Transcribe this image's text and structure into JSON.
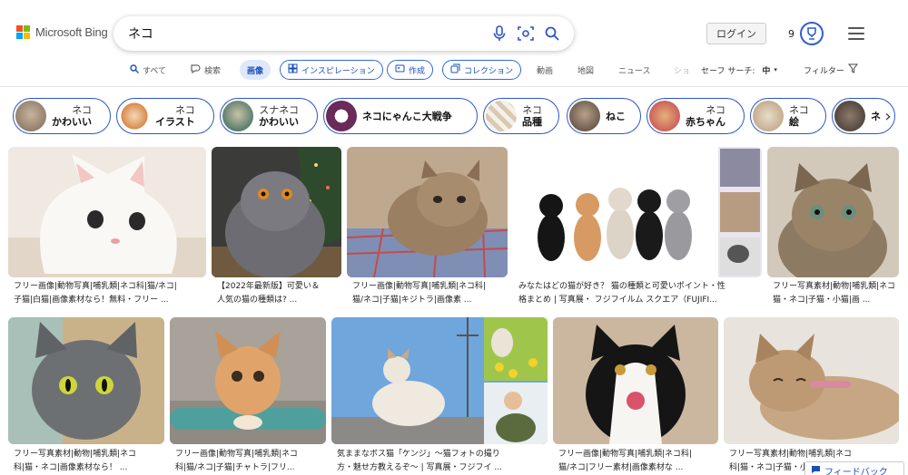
{
  "brand": {
    "name": "Microsoft Bing",
    "colors": [
      "#f25022",
      "#7fba00",
      "#00a4ef",
      "#ffb900"
    ]
  },
  "search": {
    "query": "ネコ"
  },
  "header": {
    "login_label": "ログイン",
    "rewards_count": "9"
  },
  "nav": {
    "items": [
      {
        "label": "すべて",
        "icon": "search-icon"
      },
      {
        "label": "検索",
        "icon": "copilot-icon"
      },
      {
        "label": "画像",
        "icon": ""
      },
      {
        "label": "インスピレーション",
        "icon": "inspiration-icon"
      },
      {
        "label": "作成",
        "icon": "create-icon"
      },
      {
        "label": "コレクション",
        "icon": "collection-icon"
      },
      {
        "label": "動画",
        "icon": ""
      },
      {
        "label": "地図",
        "icon": ""
      },
      {
        "label": "ニュース",
        "icon": ""
      },
      {
        "label": "ショ",
        "icon": ""
      }
    ],
    "safe_search_label": "セーフ サーチ:",
    "safe_search_value": "中",
    "filter_label": "フィルター"
  },
  "chips": [
    {
      "top": "ネコ",
      "bottom": "かわいい"
    },
    {
      "top": "ネコ",
      "bottom": "イラスト"
    },
    {
      "top": "スナネコ",
      "bottom": "かわいい"
    },
    {
      "top": "",
      "bottom": "ネコにゃんこ大戦争"
    },
    {
      "top": "ネコ",
      "bottom": "品種"
    },
    {
      "top": "",
      "bottom": "ねこ"
    },
    {
      "top": "ネコ",
      "bottom": "赤ちゃん"
    },
    {
      "top": "ネコ",
      "bottom": "絵"
    },
    {
      "top": "",
      "bottom": "ネ"
    }
  ],
  "results": [
    {
      "line1": "フリー画像|動物写真|哺乳類|ネコ科|猫/ネコ|",
      "line2": "子猫|白猫|画像素材なら！無料・フリー ..."
    },
    {
      "line1": "【2022年最新版】可愛い＆",
      "line2": "人気の猫の種類は? ..."
    },
    {
      "line1": "フリー画像|動物写真|哺乳類|ネコ科|",
      "line2": "猫/ネコ|子猫|キジトラ|画像素 ..."
    },
    {
      "line1": "みなたはどの猫が好き？ 猫の種類と可愛いポイント・性",
      "line2": "格まとめ | 写真展・ フジフイルム スクエア（FUJIFI..."
    },
    {
      "line1": "フリー写真素材|動物|哺乳類|ネコ",
      "line2": "猫・ネコ|子猫・小猫|画 ..."
    },
    {
      "line1": "フリー写真素材|動物|哺乳類|ネコ",
      "line2": "科|猫・ネコ|画像素材なら！ ..."
    },
    {
      "line1": "フリー画像|動物写真|哺乳類|ネコ",
      "line2": "科|猫/ネコ|子猫|チャトラ|フリ..."
    },
    {
      "line1": "気ままなボス猫「ケンジ」～猫フォトの撮り",
      "line2": "方・魅せ方教えるぞ～ | 写真展・フジフイ ..."
    },
    {
      "line1": "フリー画像|動物写真|哺乳類|ネコ科|",
      "line2": "猫/ネコ|フリー素材|画像素材な ..."
    },
    {
      "line1": "フリー写真素材|動物|哺乳類|ネコ",
      "line2": "科|猫・ネコ|子猫・小"
    }
  ],
  "feedback_label": "フィードバック"
}
